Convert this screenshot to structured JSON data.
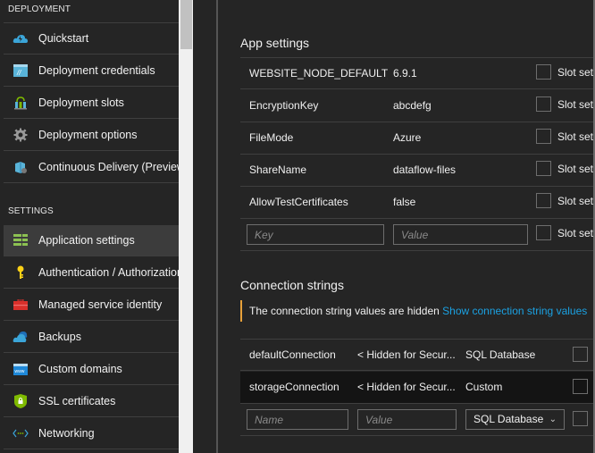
{
  "sidebar": {
    "sections": [
      {
        "header": "DEPLOYMENT",
        "items": [
          {
            "label": "Quickstart",
            "icon": "cloud-lightning-icon",
            "active": false
          },
          {
            "label": "Deployment credentials",
            "icon": "credentials-window-icon",
            "active": false
          },
          {
            "label": "Deployment slots",
            "icon": "slots-icon",
            "active": false
          },
          {
            "label": "Deployment options",
            "icon": "gear-icon",
            "active": false
          },
          {
            "label": "Continuous Delivery (Preview)",
            "icon": "continuous-delivery-icon",
            "active": false
          }
        ]
      },
      {
        "header": "SETTINGS",
        "items": [
          {
            "label": "Application settings",
            "icon": "app-settings-icon",
            "active": true
          },
          {
            "label": "Authentication / Authorization",
            "icon": "key-icon",
            "active": false
          },
          {
            "label": "Managed service identity",
            "icon": "toolbox-icon",
            "active": false
          },
          {
            "label": "Backups",
            "icon": "cloud-backup-icon",
            "active": false
          },
          {
            "label": "Custom domains",
            "icon": "www-icon",
            "active": false
          },
          {
            "label": "SSL certificates",
            "icon": "shield-lock-icon",
            "active": false
          },
          {
            "label": "Networking",
            "icon": "networking-icon",
            "active": false
          }
        ]
      }
    ]
  },
  "app_settings": {
    "title": "App settings",
    "slot_label": "Slot set",
    "rows": [
      {
        "key": "WEBSITE_NODE_DEFAULT_...",
        "value": "6.9.1",
        "slot": false
      },
      {
        "key": "EncryptionKey",
        "value": "abcdefg",
        "slot": false
      },
      {
        "key": "FileMode",
        "value": "Azure",
        "slot": false
      },
      {
        "key": "ShareName",
        "value": "dataflow-files",
        "slot": false
      },
      {
        "key": "AllowTestCertificates",
        "value": "false",
        "slot": false
      }
    ],
    "new_row": {
      "key_placeholder": "Key",
      "value_placeholder": "Value",
      "slot_label": "Slot set"
    }
  },
  "connection_strings": {
    "title": "Connection strings",
    "info_text": "The connection string values are hidden",
    "info_link": "Show connection string values",
    "colors": {
      "info_bar": "#e8a13a",
      "link": "#1ba1e2"
    },
    "rows": [
      {
        "name": "defaultConnection",
        "value": "< Hidden for Secur...",
        "type": "SQL Database"
      },
      {
        "name": "storageConnection",
        "value": "< Hidden for Secur...",
        "type": "Custom"
      }
    ],
    "new_row": {
      "name_placeholder": "Name",
      "value_placeholder": "Value",
      "type_selected": "SQL Database"
    }
  }
}
